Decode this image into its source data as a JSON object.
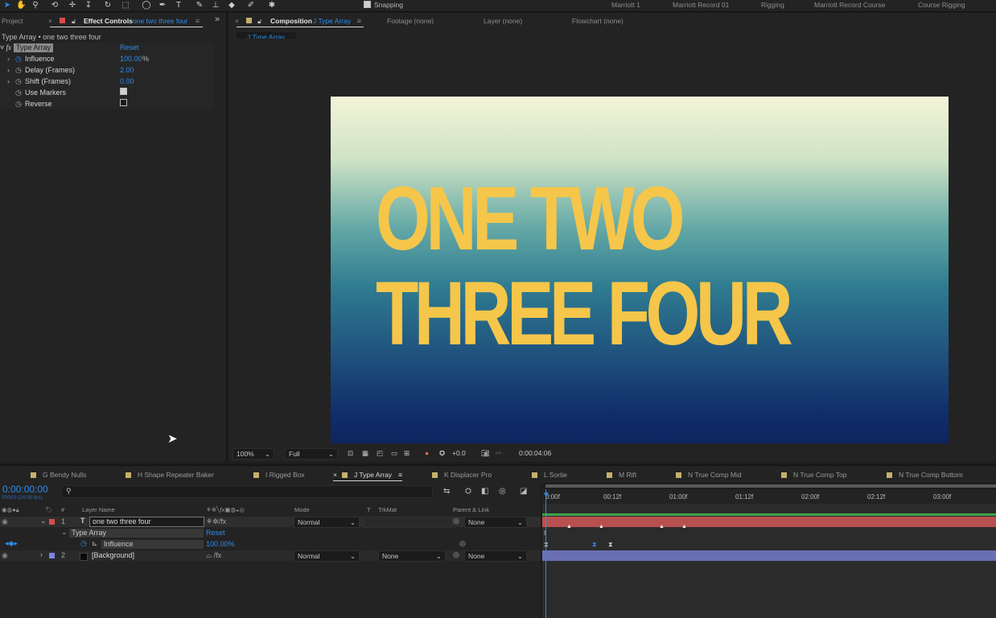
{
  "toolbar": {
    "snapping_label": "Snapping",
    "workspaces": [
      "Marriott 1",
      "Marriott Record 01",
      "Rigging",
      "Marriott Record Course",
      "Course Rigging"
    ]
  },
  "left_panel": {
    "tab_project": "Project",
    "tab_effect_controls": "Effect Controls",
    "tab_effect_controls_layer": "one two three four",
    "header": "Type Array • one two three four",
    "effect_name": "Type Array",
    "reset": "Reset",
    "properties": [
      {
        "name": "Influence",
        "value": "100.00",
        "unit": "%"
      },
      {
        "name": "Delay (Frames)",
        "value": "2.00"
      },
      {
        "name": "Shift (Frames)",
        "value": "0.00"
      },
      {
        "name": "Use Markers",
        "checked": true
      },
      {
        "name": "Reverse",
        "checked": false
      }
    ]
  },
  "comp_panel": {
    "tab_composition_prefix": "Composition",
    "tab_composition_name": "J Type Array",
    "tab_footage": "Footage (none)",
    "tab_layer": "Layer (none)",
    "tab_flowchart": "Flowchart (none)",
    "breadcrumb": "J Type Array",
    "canvas_line1": "ONE TWO",
    "canvas_line2": "THREE FOUR",
    "text_color": "#f5c64a",
    "zoom": "100%",
    "resolution": "Full",
    "exposure": "+0.0",
    "timecode": "0:00:04:06"
  },
  "timeline": {
    "tabs": [
      "G Bendy Nulls",
      "H Shape Repeater Baker",
      "I Rigged Box",
      "J Type Array",
      "K Displacer Pro",
      "L Sortie",
      "M Rift",
      "N True Comp Mid",
      "N True Comp Top",
      "N True Comp Bottom"
    ],
    "current_time": "0:00:00:00",
    "fps": "00000 (24.00 fps)",
    "columns": {
      "num": "#",
      "layer_name": "Layer Name",
      "mode": "Mode",
      "t": "T",
      "trkmat": "TrkMat",
      "parent": "Parent & Link"
    },
    "layers": [
      {
        "num": "1",
        "type": "T",
        "name": "one two three four",
        "mode": "Normal",
        "trkmat": "",
        "parent": "None"
      },
      {
        "num": "2",
        "type": "",
        "name": "[Background]",
        "mode": "Normal",
        "trkmat": "None",
        "parent": "None"
      }
    ],
    "effect_row": {
      "name": "Type Array",
      "reset": "Reset"
    },
    "influence_row": {
      "name": "Influence",
      "value": "100.00%"
    },
    "ruler": [
      "0:00f",
      "00:12f",
      "01:00f",
      "01:12f",
      "02:00f",
      "02:12f",
      "03:00f"
    ]
  }
}
